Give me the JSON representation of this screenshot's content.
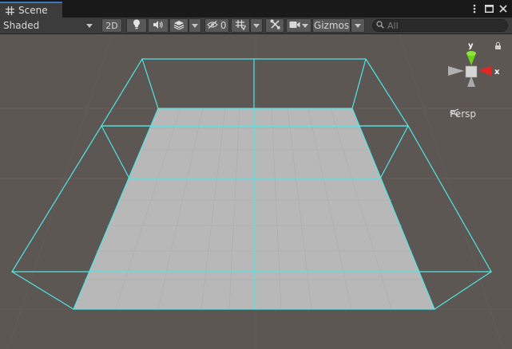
{
  "window": {
    "tab": {
      "label": "Scene",
      "icon": "grid-icon"
    },
    "actions": [
      "more-vert-icon",
      "maximize-icon",
      "close-icon"
    ]
  },
  "toolbar": {
    "shading_mode": "Shaded",
    "mode_2d": "2D",
    "hidden_count": "0",
    "gizmos_label": "Gizmos",
    "search_placeholder": "All",
    "icons": [
      "lightbulb-icon",
      "speaker-icon",
      "layers-icon",
      "eye-slash-icon",
      "grid-toggle-icon",
      "tools-icon",
      "camera-icon",
      "search-icon"
    ]
  },
  "viewport": {
    "projection": "Persp",
    "axis_labels": {
      "x": "x",
      "y": "y"
    },
    "colors": {
      "background": "#5c5752",
      "plane": "#b9b9b9",
      "wireframe": "#4fe6e6",
      "axis_x": "#e22727",
      "axis_y": "#6fd11b"
    }
  }
}
